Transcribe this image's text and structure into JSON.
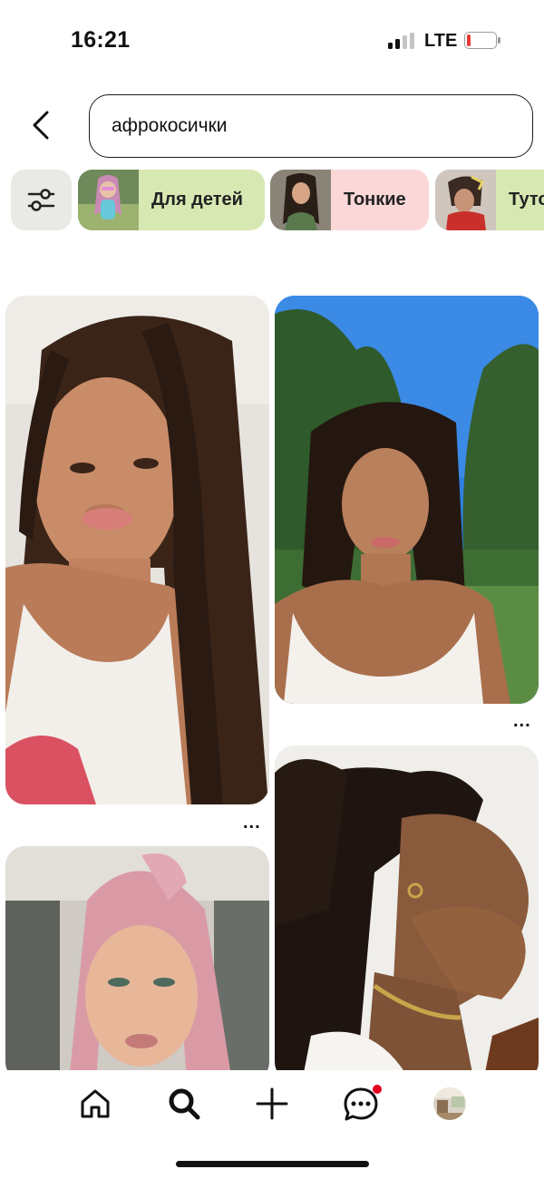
{
  "status_bar": {
    "time": "16:21",
    "network": "LTE"
  },
  "search": {
    "query": "афрокосички"
  },
  "filters": {
    "icon": "sliders-icon",
    "chips": [
      {
        "label": "Для детей",
        "color": "#d8e8b2"
      },
      {
        "label": "Тонкие",
        "color": "#fbd7d7"
      },
      {
        "label": "Туто",
        "color": "#d8e8b2"
      }
    ]
  },
  "pins": [
    {
      "description": "woman with long dark box braids, white tank top"
    },
    {
      "description": "woman with shoulder-length box braids outdoors, trees and blue sky"
    },
    {
      "description": "woman with pink braided high ponytail"
    },
    {
      "description": "profile of woman with cornrow braids and half ponytail, hand on cheek"
    }
  ],
  "more_label": "...",
  "bottom_nav": {
    "items": [
      "home-icon",
      "search-icon",
      "plus-icon",
      "messages-icon",
      "profile-avatar"
    ],
    "active": "search-icon",
    "notification_dot_color": "#e60023"
  },
  "colors": {
    "battery_low": "#e53935",
    "text": "#111111"
  }
}
